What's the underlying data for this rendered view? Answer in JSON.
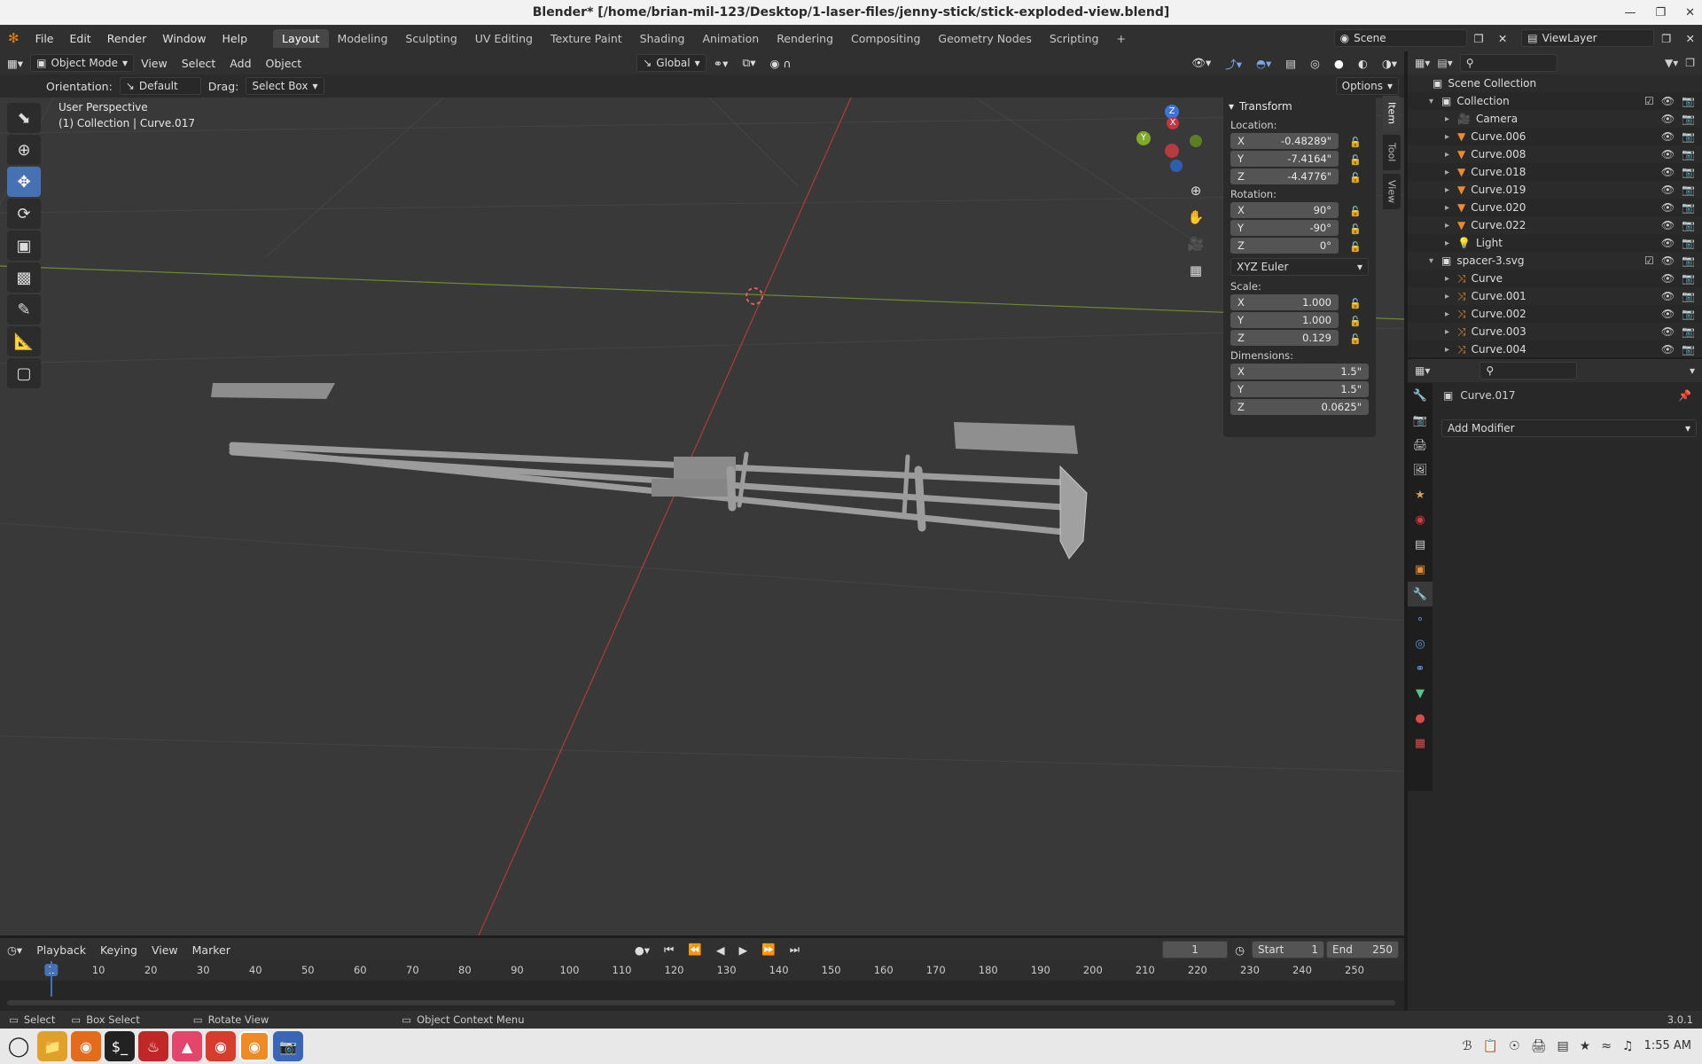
{
  "window": {
    "title": "Blender* [/home/brian-mil-123/Desktop/1-laser-files/jenny-stick/stick-exploded-view.blend]"
  },
  "menu": [
    "File",
    "Edit",
    "Render",
    "Window",
    "Help"
  ],
  "workspaces": [
    "Layout",
    "Modeling",
    "Sculpting",
    "UV Editing",
    "Texture Paint",
    "Shading",
    "Animation",
    "Rendering",
    "Compositing",
    "Geometry Nodes",
    "Scripting"
  ],
  "scene": {
    "name": "Scene",
    "view_layer": "ViewLayer"
  },
  "viewport_header": {
    "mode": "Object Mode",
    "items": [
      "View",
      "Select",
      "Add",
      "Object"
    ],
    "transform": "Global"
  },
  "viewport_header2": {
    "orientation_label": "Orientation:",
    "orientation": "Default",
    "drag_label": "Drag:",
    "drag": "Select Box",
    "options": "Options"
  },
  "viewport": {
    "perspective": "User Perspective",
    "collection_info": "(1) Collection | Curve.017"
  },
  "npanel": {
    "section": "Transform",
    "location_label": "Location:",
    "location": [
      {
        "axis": "X",
        "value": "-0.48289\""
      },
      {
        "axis": "Y",
        "value": "-7.4164\""
      },
      {
        "axis": "Z",
        "value": "-4.4776\""
      }
    ],
    "rotation_label": "Rotation:",
    "rotation": [
      {
        "axis": "X",
        "value": "90°"
      },
      {
        "axis": "Y",
        "value": "-90°"
      },
      {
        "axis": "Z",
        "value": "0°"
      }
    ],
    "rotation_mode": "XYZ Euler",
    "scale_label": "Scale:",
    "scale": [
      {
        "axis": "X",
        "value": "1.000"
      },
      {
        "axis": "Y",
        "value": "1.000"
      },
      {
        "axis": "Z",
        "value": "0.129"
      }
    ],
    "dimensions_label": "Dimensions:",
    "dimensions": [
      {
        "axis": "X",
        "value": "1.5\""
      },
      {
        "axis": "Y",
        "value": "1.5\""
      },
      {
        "axis": "Z",
        "value": "0.0625\""
      }
    ],
    "tabs": [
      "Item",
      "Tool",
      "View"
    ]
  },
  "outliner": {
    "root": "Scene Collection",
    "rows": [
      {
        "name": "Collection",
        "indent": 1,
        "type": "collection"
      },
      {
        "name": "Camera",
        "indent": 2,
        "type": "camera"
      },
      {
        "name": "Curve.006",
        "indent": 2,
        "type": "mesh"
      },
      {
        "name": "Curve.008",
        "indent": 2,
        "type": "mesh"
      },
      {
        "name": "Curve.018",
        "indent": 2,
        "type": "mesh"
      },
      {
        "name": "Curve.019",
        "indent": 2,
        "type": "mesh"
      },
      {
        "name": "Curve.020",
        "indent": 2,
        "type": "mesh"
      },
      {
        "name": "Curve.022",
        "indent": 2,
        "type": "mesh"
      },
      {
        "name": "Light",
        "indent": 2,
        "type": "light"
      },
      {
        "name": "spacer-3.svg",
        "indent": 1,
        "type": "collection"
      },
      {
        "name": "Curve",
        "indent": 2,
        "type": "curve"
      },
      {
        "name": "Curve.001",
        "indent": 2,
        "type": "curve"
      },
      {
        "name": "Curve.002",
        "indent": 2,
        "type": "curve"
      },
      {
        "name": "Curve.003",
        "indent": 2,
        "type": "curve"
      },
      {
        "name": "Curve.004",
        "indent": 2,
        "type": "curve"
      }
    ]
  },
  "properties": {
    "object_name": "Curve.017",
    "add_modifier": "Add Modifier"
  },
  "timeline": {
    "menus": [
      "Playback",
      "Keying",
      "View",
      "Marker"
    ],
    "current_frame": "1",
    "start_label": "Start",
    "start": "1",
    "end_label": "End",
    "end": "250",
    "ticks": [
      "1",
      "10",
      "20",
      "30",
      "40",
      "50",
      "60",
      "70",
      "80",
      "90",
      "100",
      "110",
      "120",
      "130",
      "140",
      "150",
      "160",
      "170",
      "180",
      "190",
      "200",
      "210",
      "220",
      "230",
      "240",
      "250"
    ]
  },
  "statusbar": {
    "select": "Select",
    "box_select": "Box Select",
    "rotate": "Rotate View",
    "context": "Object Context Menu",
    "version": "3.0.1"
  },
  "taskbar": {
    "time": "1:55 AM"
  }
}
